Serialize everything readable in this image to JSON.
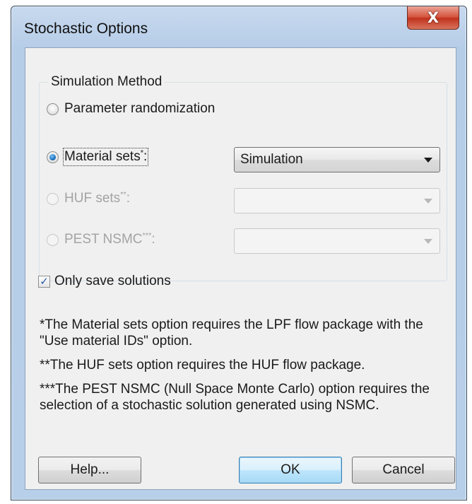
{
  "window": {
    "title": "Stochastic Options",
    "close_glyph": "X"
  },
  "simulation_method": {
    "legend": "Simulation Method",
    "options": [
      {
        "label": "Parameter randomization",
        "selected": false,
        "enabled": true
      },
      {
        "label": "Material sets",
        "marker": "*",
        "suffix": ":",
        "selected": true,
        "enabled": true,
        "combo_value": "Simulation"
      },
      {
        "label": "HUF sets",
        "marker": "**",
        "suffix": ":",
        "selected": false,
        "enabled": false,
        "combo_value": ""
      },
      {
        "label": "PEST NSMC",
        "marker": "***",
        "suffix": ":",
        "selected": false,
        "enabled": false,
        "combo_value": ""
      }
    ]
  },
  "only_save_solutions": {
    "label": "Only save solutions",
    "checked": true,
    "check_glyph": "✓"
  },
  "notes": [
    "*The Material sets option requires the LPF flow package with the \"Use material IDs\" option.",
    "**The HUF sets option requires the HUF flow package.",
    "***The PEST NSMC (Null Space Monte Carlo) option requires the selection of a stochastic solution generated using NSMC."
  ],
  "buttons": {
    "help": "Help...",
    "ok": "OK",
    "cancel": "Cancel"
  }
}
